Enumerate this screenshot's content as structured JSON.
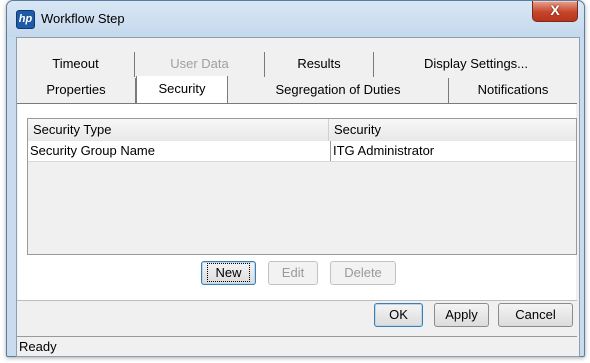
{
  "window": {
    "title": "Workflow Step",
    "icon_text": "hp",
    "close_symbol": "X"
  },
  "tabs": {
    "back_row": [
      {
        "label": "Timeout",
        "disabled": false
      },
      {
        "label": "User Data",
        "disabled": true
      },
      {
        "label": "Results",
        "disabled": false
      },
      {
        "label": "Display Settings...",
        "disabled": false
      }
    ],
    "front_row": [
      {
        "label": "Properties",
        "selected": false
      },
      {
        "label": "Security",
        "selected": true
      },
      {
        "label": "Segregation of Duties",
        "selected": false
      },
      {
        "label": "Notifications",
        "selected": false
      }
    ]
  },
  "security_table": {
    "columns": [
      "Security Type",
      "Security"
    ],
    "rows": [
      [
        "Security Group Name",
        "ITG Administrator"
      ]
    ]
  },
  "table_actions": {
    "new_label": "New",
    "edit_label": "Edit",
    "delete_label": "Delete"
  },
  "dialog_actions": {
    "ok_label": "OK",
    "apply_label": "Apply",
    "cancel_label": "Cancel"
  },
  "status_bar": {
    "text": "Ready"
  }
}
